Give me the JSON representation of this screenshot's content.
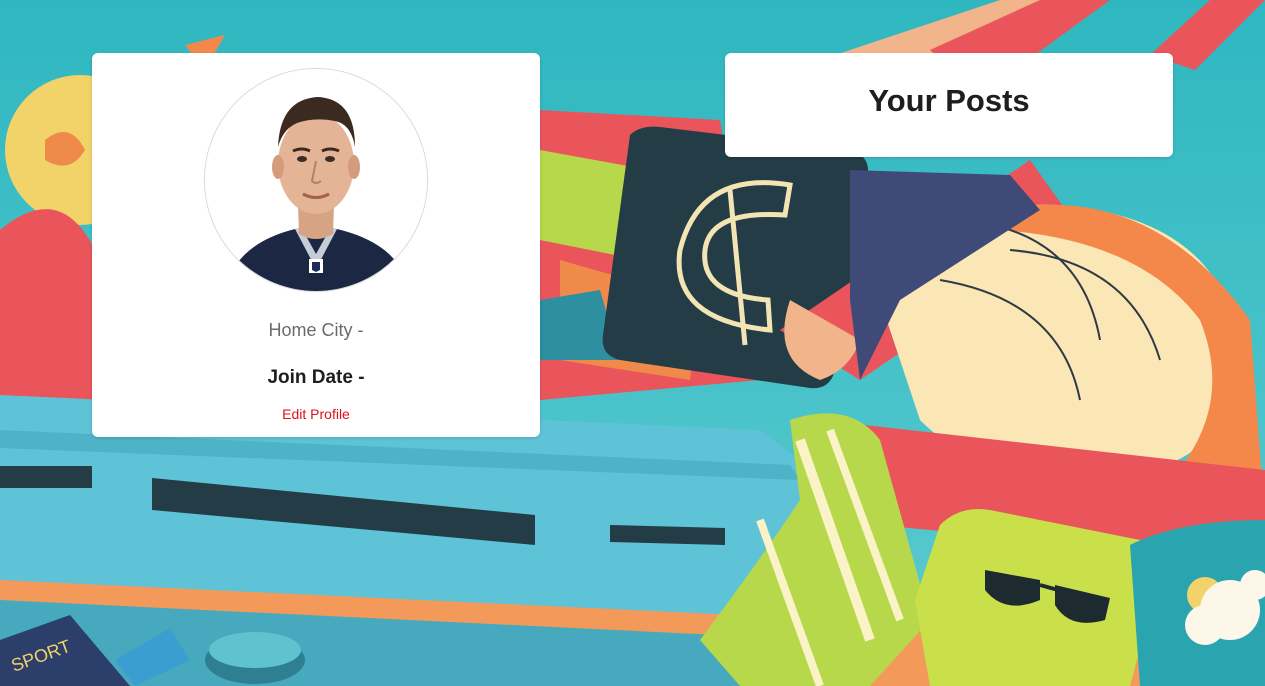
{
  "profile": {
    "home_city_label": "Home City -",
    "join_date_label": "Join Date -",
    "edit_profile_label": "Edit Profile"
  },
  "posts": {
    "title": "Your Posts"
  },
  "decor": {
    "passport_text": "SPORT"
  },
  "colors": {
    "link": "#e0101a",
    "card_bg": "#ffffff",
    "background_teal": "#3bbcc3"
  }
}
